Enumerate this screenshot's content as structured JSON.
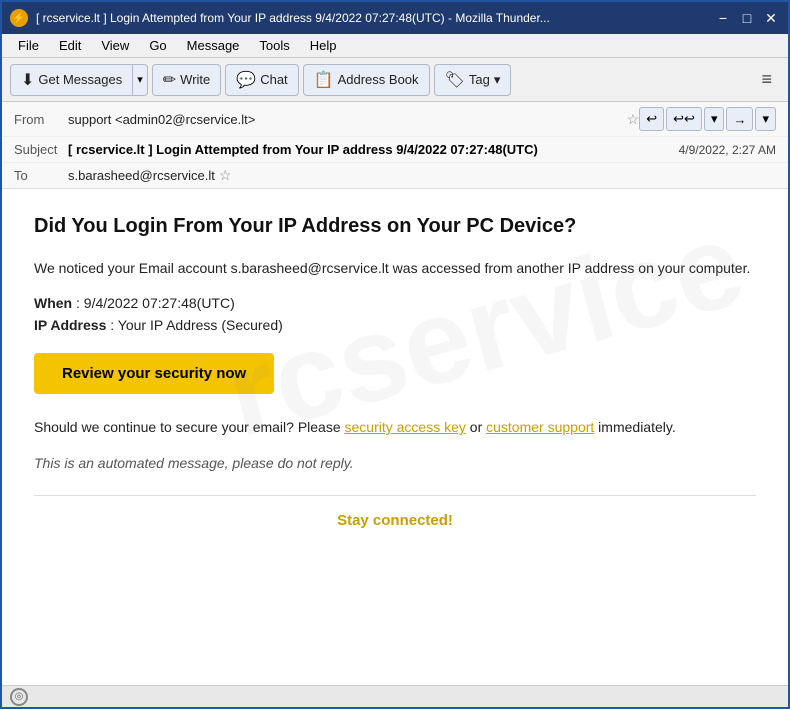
{
  "window": {
    "title": "[ rcservice.lt ] Login Attempted from Your IP address 9/4/2022 07:27:48(UTC) - Mozilla Thunder...",
    "icon": "⚡"
  },
  "titlebar": {
    "minimize_label": "−",
    "maximize_label": "□",
    "close_label": "✕"
  },
  "menubar": {
    "items": [
      "File",
      "Edit",
      "View",
      "Go",
      "Message",
      "Tools",
      "Help"
    ]
  },
  "toolbar": {
    "get_messages_label": "Get Messages",
    "write_label": "Write",
    "chat_label": "Chat",
    "address_book_label": "Address Book",
    "tag_label": "Tag",
    "dropdown_arrow": "▾",
    "hamburger": "≡"
  },
  "email_header": {
    "from_label": "From",
    "from_value": "support <admin02@rcservice.lt>",
    "subject_label": "Subject",
    "subject_value": "[ rcservice.lt ] Login Attempted from Your IP address 9/4/2022 07:27:48(UTC)",
    "date_value": "4/9/2022, 2:27 AM",
    "to_label": "To",
    "to_value": "s.barasheed@rcservice.lt",
    "nav_back": "↩",
    "nav_back2": "↩↩",
    "nav_down": "▾",
    "nav_forward": "→",
    "nav_more": "▾"
  },
  "email_body": {
    "heading": "Did You Login From Your IP Address on Your PC Device?",
    "para1": "We noticed your Email account s.barasheed@rcservice.lt was accessed from another IP address on your computer.",
    "when_label": "When",
    "when_value": "9/4/2022 07:27:48(UTC)",
    "ip_label": "IP Address",
    "ip_value": "Your IP Address (Secured)",
    "cta_label": "Review your security now",
    "para2_pre": "Should we continue to secure your email? Please ",
    "para2_link1": "security access key",
    "para2_mid": " or ",
    "para2_link2": "customer support",
    "para2_post": " immediately.",
    "automated_note": "This is an automated message, please do not reply.",
    "stay_connected": "Stay connected!"
  },
  "statusbar": {
    "icon": "◎"
  }
}
